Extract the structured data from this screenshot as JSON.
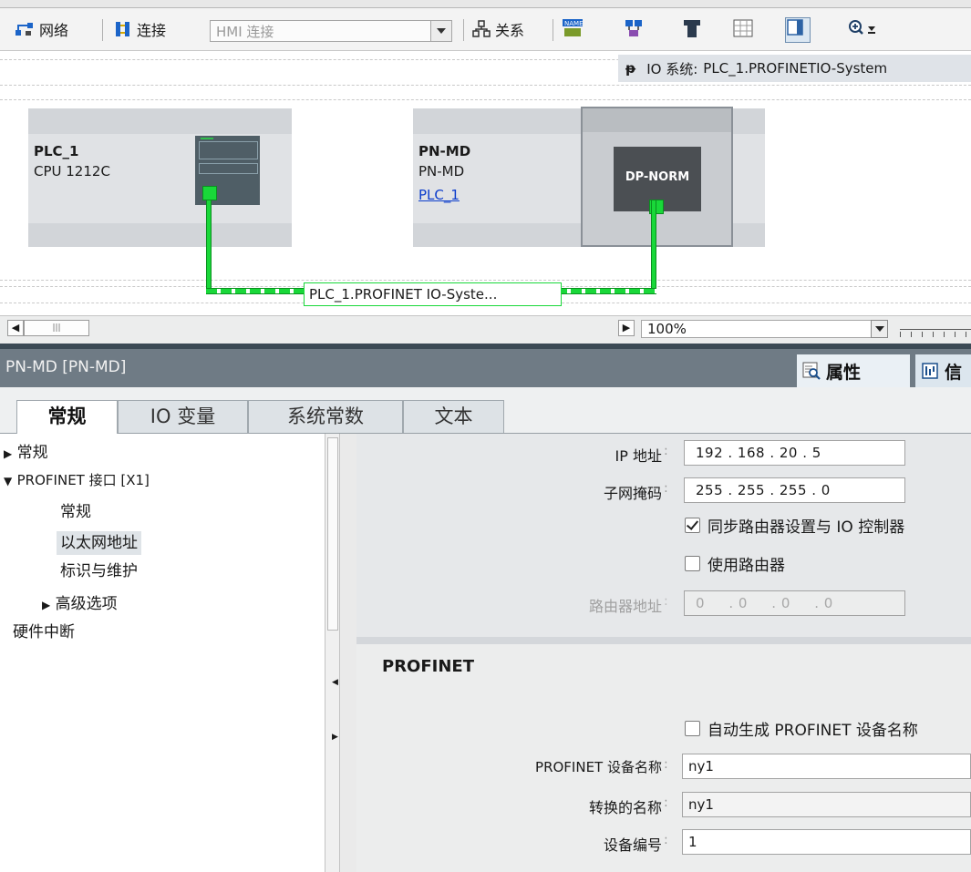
{
  "toolbar": {
    "network_label": "网络",
    "connection_label": "连接",
    "connection_type_value": "HMI 连接",
    "relation_label": "关系"
  },
  "network_view": {
    "io_system_prefix": "IO 系统:",
    "io_system_name": "PLC_1.PROFINETIO-System",
    "devices": [
      {
        "name": "PLC_1",
        "type": "CPU 1212C"
      },
      {
        "name": "PN-MD",
        "type": "PN-MD",
        "assigned_controller": "PLC_1",
        "module_label": "DP-NORM"
      }
    ],
    "network_line_label": "PLC_1.PROFINET IO-Syste...",
    "zoom": "100%"
  },
  "inspector": {
    "title": "PN-MD [PN-MD]",
    "tabs": [
      {
        "label": "属性",
        "icon": "properties-icon"
      },
      {
        "label": "信",
        "icon": "info-icon"
      }
    ],
    "content_tabs": [
      "常规",
      "IO 变量",
      "系统常数",
      "文本"
    ],
    "active_content_tab": "常规"
  },
  "tree": {
    "items": [
      {
        "label": "常规",
        "expander": "▶"
      },
      {
        "label": "PROFINET 接口 [X1]",
        "expander": "▼"
      },
      {
        "label": "常规"
      },
      {
        "label": "以太网地址",
        "selected": true
      },
      {
        "label": "标识与维护"
      },
      {
        "label": "高级选项",
        "expander": "▶"
      },
      {
        "label": "硬件中断"
      }
    ]
  },
  "ip_section": {
    "ip_label": "IP 地址",
    "ip_value": "192 . 168 . 20  . 5",
    "subnet_label": "子网掩码",
    "subnet_value": "255 . 255 . 255 . 0",
    "sync_router_label": "同步路由器设置与 IO 控制器",
    "sync_router_checked": true,
    "use_router_label": "使用路由器",
    "use_router_checked": false,
    "router_address_label": "路由器地址",
    "router_address_value": "0     . 0     . 0     . 0"
  },
  "profinet_section": {
    "title": "PROFINET",
    "auto_generate_label": "自动生成 PROFINET 设备名称",
    "auto_generate_checked": false,
    "device_name_label": "PROFINET 设备名称",
    "device_name_value": "ny1",
    "converted_name_label": "转换的名称",
    "converted_name_value": "ny1",
    "device_number_label": "设备编号",
    "device_number_value": "1"
  },
  "colors": {
    "network_green": "#19d839",
    "header_bar": "#6f7b85",
    "link_blue": "#0b3ccc"
  }
}
